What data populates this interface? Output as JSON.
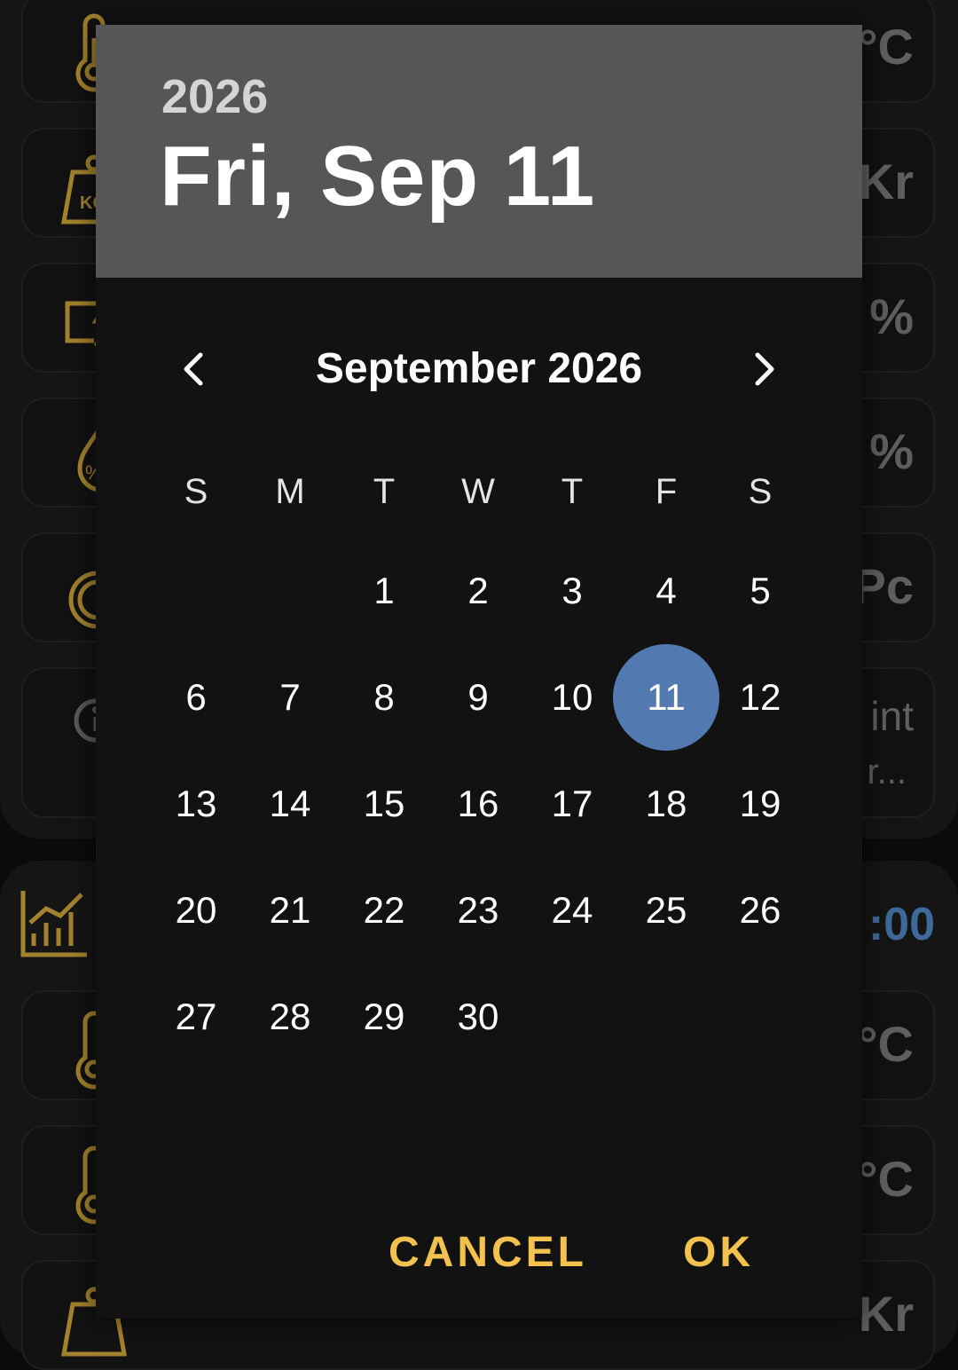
{
  "background": {
    "cards": [
      {
        "icon": "thermometer-icon",
        "value": "°C"
      },
      {
        "icon": "weight-kg-icon",
        "value": "Kr"
      },
      {
        "icon": "power-monitor-icon",
        "value": "%"
      },
      {
        "icon": "humidity-drop-icon",
        "value": "%"
      },
      {
        "icon": "gauge-icon",
        "value": "Pc"
      },
      {
        "icon": "info-icon",
        "value": "int",
        "value2": "r..."
      },
      {
        "icon": "thermometer-icon",
        "value": "°C"
      },
      {
        "icon": "thermometer-icon",
        "value": "°C"
      },
      {
        "icon": "weight-kg-icon",
        "value": "Kr"
      }
    ],
    "chart_value": ":00"
  },
  "dialog": {
    "header_year": "2026",
    "header_date": "Fri, Sep 11",
    "month_title": "September 2026",
    "weekdays": [
      "S",
      "M",
      "T",
      "W",
      "T",
      "F",
      "S"
    ],
    "first_weekday_index": 2,
    "days_in_month": 30,
    "selected_day": 11,
    "cancel_label": "CANCEL",
    "ok_label": "OK"
  },
  "colors": {
    "accent": "#f2c14e",
    "selected": "#527ab0",
    "header_bg": "#565656",
    "dialog_bg": "#121212",
    "icon_gold": "#a4832e"
  }
}
